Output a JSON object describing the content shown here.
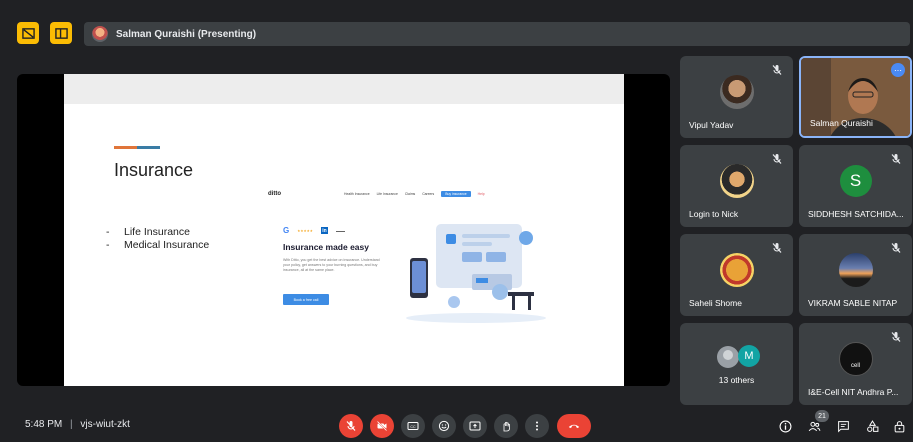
{
  "topbar": {
    "presenter_label": "Salman Quraishi (Presenting)"
  },
  "slide": {
    "title": "Insurance",
    "bullets": [
      "Life Insurance",
      "Medical Insurance"
    ],
    "website": {
      "logo": "ditto",
      "nav": [
        "Health Insurance",
        "Life Insurance",
        "Claims",
        "Careers",
        "Buy insurance",
        "Help"
      ],
      "heading": "Insurance made easy",
      "paragraph": "With Ditto, you get the best advice on insurance. Understand your policy, get answers to your burning questions, and buy insurance, all at the same place.",
      "cta": "Book a free call"
    }
  },
  "participants": [
    {
      "name": "Vipul Yadav"
    },
    {
      "name": "Salman Quraishi"
    },
    {
      "name": "Login to Nick"
    },
    {
      "name": "SIDDHESH SATCHIDA...",
      "initial": "S"
    },
    {
      "name": "Saheli Shome"
    },
    {
      "name": "VIKRAM SABLE NITAP"
    },
    {
      "name": "13 others",
      "initial": "M"
    },
    {
      "name": "I&E-Cell NIT Andhra P...",
      "logo_text": "cell"
    }
  ],
  "bottombar": {
    "time": "5:48 PM",
    "meeting_code": "vjs-wiut-zkt",
    "people_count": "21"
  },
  "colors": {
    "background": "#202124",
    "tile": "#3c4043",
    "danger": "#ea4335",
    "accent_yellow": "#fbbc04",
    "active_border": "#8ab4f8"
  }
}
